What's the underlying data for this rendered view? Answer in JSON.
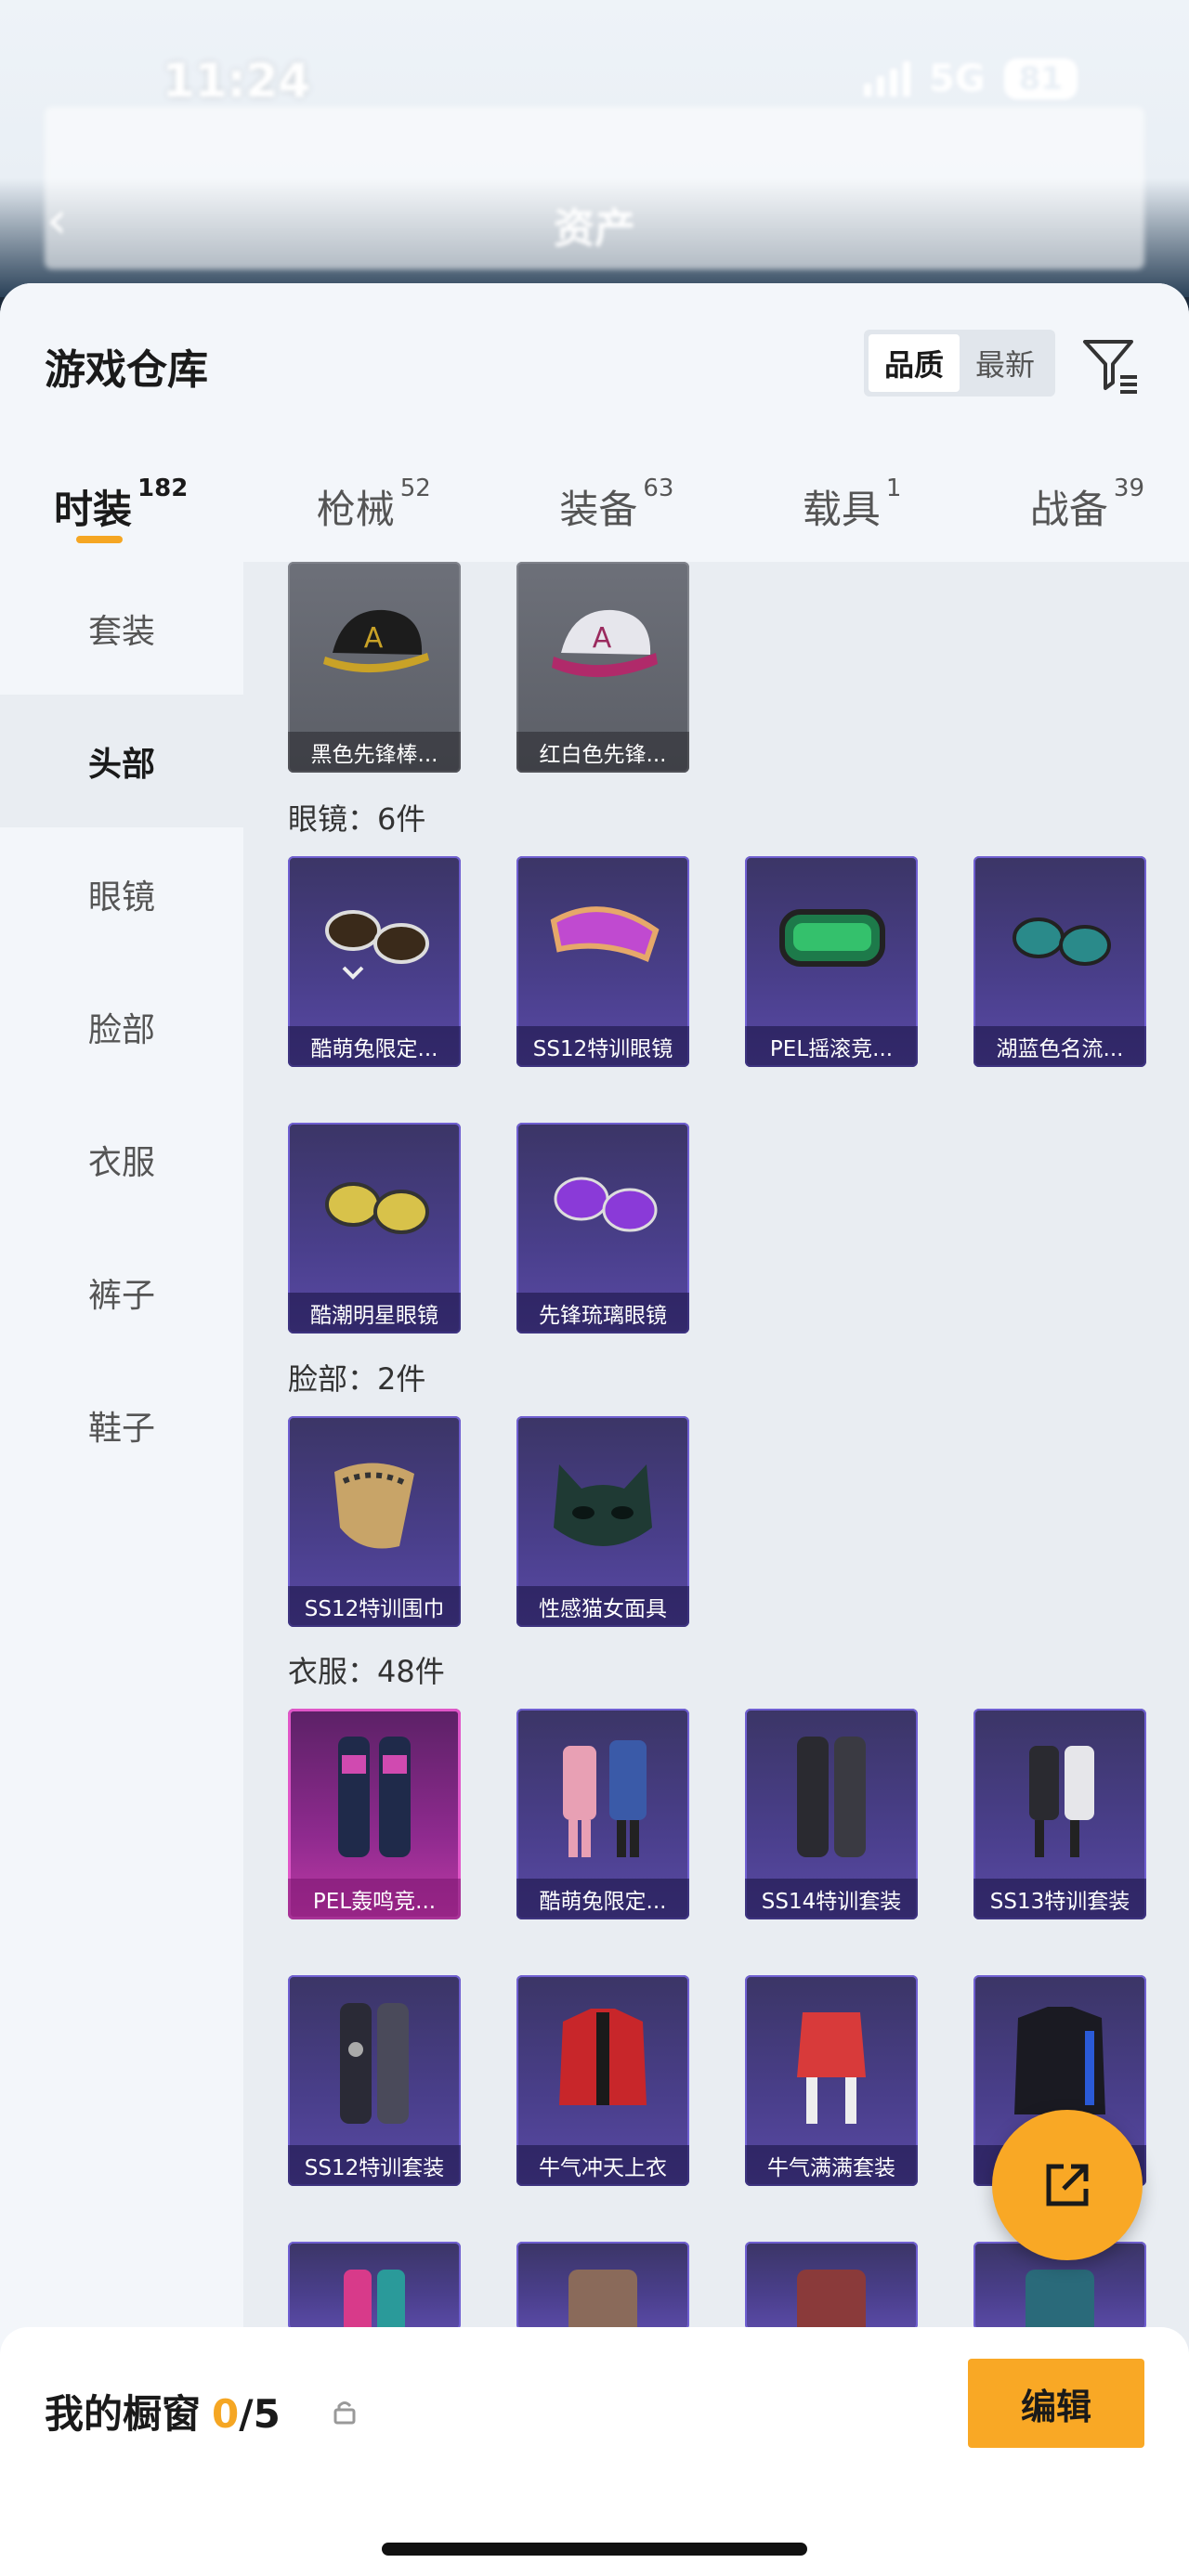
{
  "status": {
    "time": "11:24",
    "network": "5G",
    "battery": "81"
  },
  "header": {
    "title": "资产"
  },
  "sheet": {
    "title": "游戏仓库"
  },
  "sort": {
    "options": [
      "品质",
      "最新"
    ],
    "selected": "品质"
  },
  "tabs": [
    {
      "label": "时装",
      "count": "182",
      "active": true
    },
    {
      "label": "枪械",
      "count": "52"
    },
    {
      "label": "装备",
      "count": "63"
    },
    {
      "label": "载具",
      "count": "1"
    },
    {
      "label": "战备",
      "count": "39"
    }
  ],
  "sidebar": {
    "items": [
      {
        "label": "套装"
      },
      {
        "label": "头部",
        "active": true
      },
      {
        "label": "眼镜"
      },
      {
        "label": "脸部"
      },
      {
        "label": "衣服"
      },
      {
        "label": "裤子"
      },
      {
        "label": "鞋子"
      }
    ]
  },
  "sections": {
    "glasses": "眼镜：6件",
    "face": "脸部：2件",
    "clothes": "衣服：48件"
  },
  "items": {
    "head": [
      "黑色先锋棒...",
      "红白色先锋..."
    ],
    "glasses": [
      "酷萌兔限定...",
      "SS12特训眼镜",
      "PEL摇滚竞...",
      "湖蓝色名流...",
      "酷潮明星眼镜",
      "先锋琉璃眼镜"
    ],
    "face": [
      "SS12特训围巾",
      "性感猫女面具"
    ],
    "clothes": [
      "PEL轰鸣竞...",
      "酷萌兔限定...",
      "SS14特训套装",
      "SS13特训套装",
      "SS12特训套装",
      "牛气冲天上衣",
      "牛气满满套装",
      ""
    ]
  },
  "showcase": {
    "title": "我的橱窗",
    "current": "0",
    "total": "/5"
  },
  "edit_button": "编辑",
  "colors": {
    "accent": "#f9a825",
    "card_purple": "#4a3f8c",
    "card_pink": "#c03aa6",
    "card_gray": "#5b5e66"
  }
}
